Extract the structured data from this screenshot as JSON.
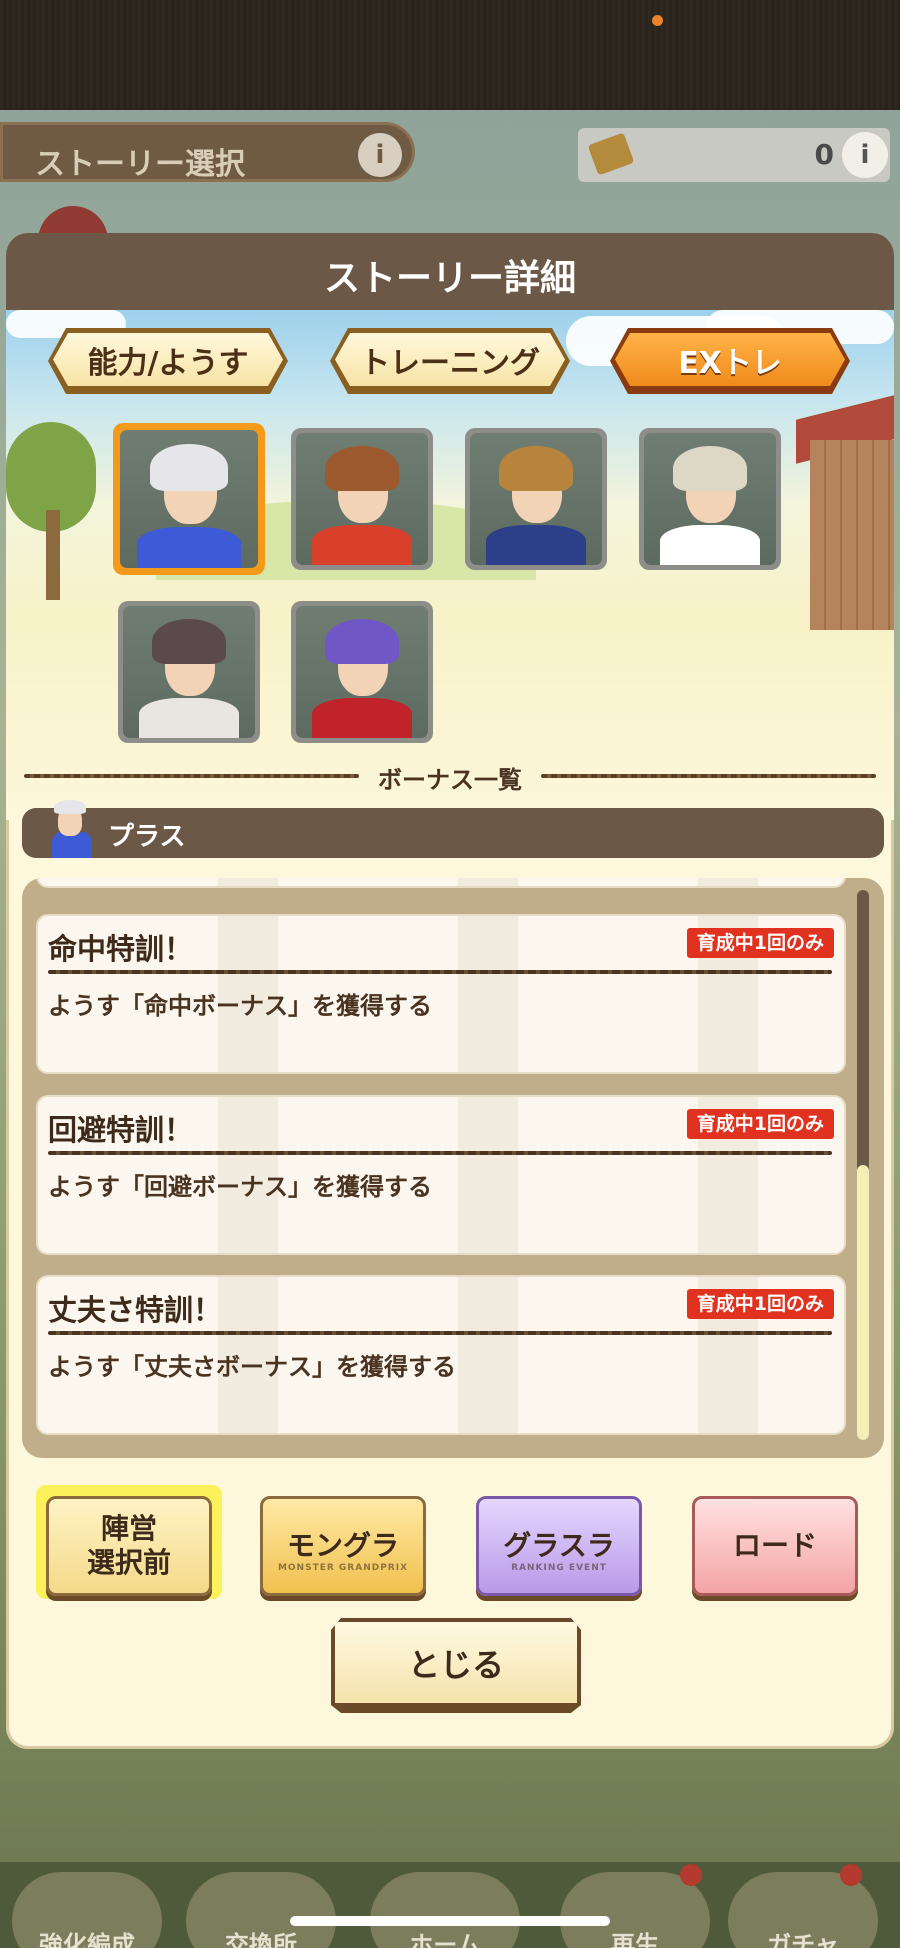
{
  "background": {
    "header_label": "ストーリー選択",
    "info_glyph": "i",
    "currency_value": "0",
    "nav": [
      "強化編成",
      "交換所",
      "ホーム",
      "再生",
      "ガチャ"
    ]
  },
  "modal": {
    "title": "ストーリー詳細",
    "tabs": [
      {
        "label": "能力/ようす",
        "active": false
      },
      {
        "label": "トレーニング",
        "active": false
      },
      {
        "label": "EXトレ",
        "active": true
      }
    ],
    "characters": [
      {
        "id": "plus",
        "selected": true,
        "hair": "#e6e6ea",
        "body": "#3d5bd6"
      },
      {
        "id": "girl-red",
        "selected": false,
        "hair": "#9c5a2e",
        "body": "#d8402c"
      },
      {
        "id": "boy-cap",
        "selected": false,
        "hair": "#b8833c",
        "body": "#2c3f88"
      },
      {
        "id": "girl-white",
        "selected": false,
        "hair": "#ddd7c6",
        "body": "#ffffff"
      },
      {
        "id": "man-dark",
        "selected": false,
        "hair": "#5a4a4c",
        "body": "#e9e6e0"
      },
      {
        "id": "man-purple",
        "selected": false,
        "hair": "#6f58c6",
        "body": "#c0232a"
      }
    ],
    "bonus_section_title": "ボーナス一覧",
    "selected_character_name": "プラス",
    "bonuses": [
      {
        "title": "命中特訓！",
        "badge": "育成中1回のみ",
        "description": "ようす「命中ボーナス」を獲得する"
      },
      {
        "title": "回避特訓！",
        "badge": "育成中1回のみ",
        "description": "ようす「回避ボーナス」を獲得する"
      },
      {
        "title": "丈夫さ特訓！",
        "badge": "育成中1回のみ",
        "description": "ようす「丈夫さボーナス」を獲得する"
      }
    ],
    "scroll_position": 0.5,
    "factions": [
      {
        "label_line1": "陣営",
        "label_line2": "選択前",
        "sub": "",
        "selected": true
      },
      {
        "label_line1": "モングラ",
        "label_line2": "",
        "sub": "MONSTER GRANDPRIX",
        "selected": false
      },
      {
        "label_line1": "グラスラ",
        "label_line2": "",
        "sub": "RANKING EVENT",
        "selected": false
      },
      {
        "label_line1": "ロード",
        "label_line2": "",
        "sub": "",
        "selected": false
      }
    ],
    "close_label": "とじる"
  },
  "colors": {
    "accent_orange": "#f08a1c",
    "badge_red": "#e0321f",
    "title_brown": "#6b5847"
  }
}
